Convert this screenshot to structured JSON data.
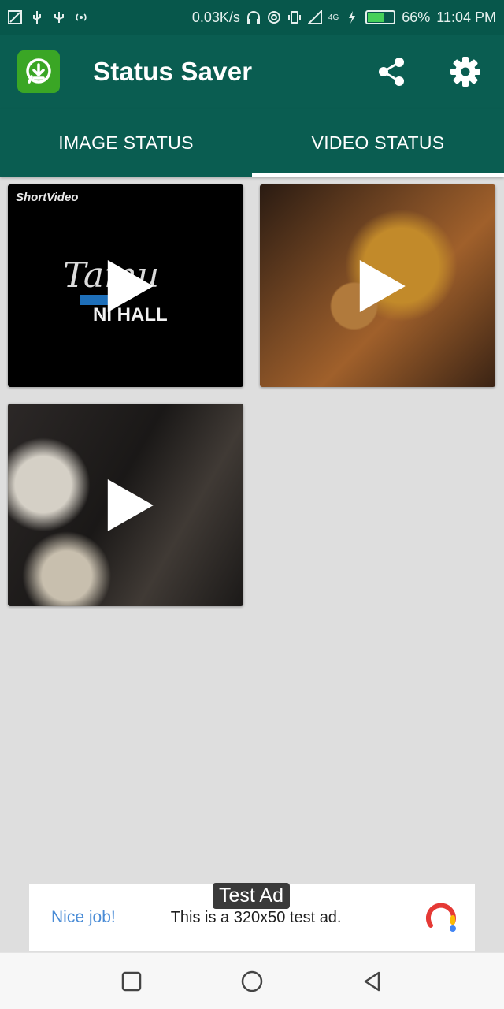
{
  "status_bar": {
    "speed": "0.03K/s",
    "battery": "66%",
    "battery_level": 0.66,
    "time": "11:04 PM",
    "network": "4G",
    "left_icons": [
      "screenshot-icon",
      "usb-icon",
      "usb-debug-icon",
      "hotspot-icon"
    ],
    "right_icons": [
      "headphones-icon",
      "nfc-icon",
      "vibrate-icon",
      "signal-icon",
      "charging-icon"
    ]
  },
  "appbar": {
    "title": "Status Saver",
    "logo_icon": "whatsapp-download-icon",
    "actions": [
      "share-icon",
      "settings-icon"
    ]
  },
  "tabs": [
    {
      "label": "IMAGE STATUS",
      "active": false
    },
    {
      "label": "VIDEO STATUS",
      "active": true
    }
  ],
  "videos": [
    {
      "thumb_text": "Tamu",
      "thumb_line": "NI HALL",
      "watermark": "ShortVideo"
    },
    {},
    {}
  ],
  "ad": {
    "label": "Test Ad",
    "headline": "Nice job!",
    "body": "This is a 320x50 test ad."
  },
  "nav": [
    "recents-icon",
    "home-icon",
    "back-icon"
  ],
  "colors": {
    "primary": "#0a5d51",
    "status_bar": "#07574b",
    "accent_green": "#3aa625",
    "background": "#dedede",
    "ad_link": "#4a8cd6"
  }
}
